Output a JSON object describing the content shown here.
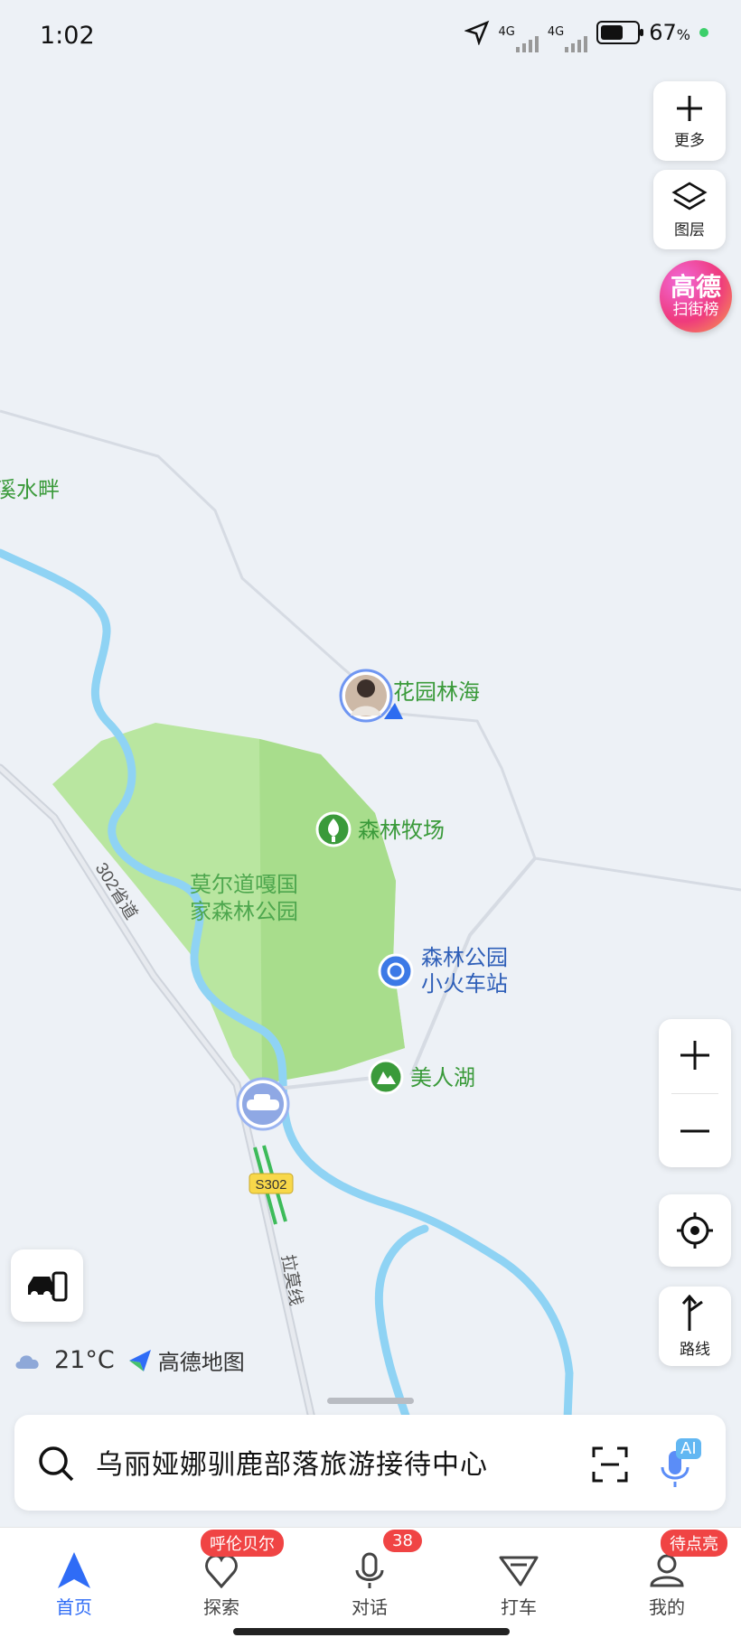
{
  "status": {
    "time": "1:02",
    "net1": "4G",
    "net2": "4G",
    "battery": "67",
    "battery_unit": "%",
    "battery_level": 0.67
  },
  "controls": {
    "more_label": "更多",
    "layers_label": "图层",
    "rank_line1": "高德",
    "rank_line2": "扫街榜",
    "route_label": "路线"
  },
  "map": {
    "labels": {
      "partial_place": "溪水畔",
      "user_place": "花园林海",
      "forest_ranch": "森林牧场",
      "park_line1": "莫尔道嘎国",
      "park_line2": "家森林公园",
      "train_line1": "森林公园",
      "train_line2": "小火车站",
      "lake": "美人湖",
      "road_302": "302省道",
      "road_s302": "S302",
      "road_lamo": "拉莫线"
    }
  },
  "weather": {
    "temp": "21°C",
    "brand": "高德地图"
  },
  "search": {
    "text": "乌丽娅娜驯鹿部落旅游接待中心",
    "ai_badge": "AI"
  },
  "tabs": [
    {
      "label": "首页",
      "badge": ""
    },
    {
      "label": "探索",
      "badge": "呼伦贝尔"
    },
    {
      "label": "对话",
      "badge": "38"
    },
    {
      "label": "打车",
      "badge": ""
    },
    {
      "label": "我的",
      "badge": "待点亮"
    }
  ],
  "colors": {
    "accent": "#2f6cf6",
    "badge": "#f04444",
    "park": "#b9e6a0",
    "river": "#8fd3f4",
    "poi_green": "#3a9a3a"
  }
}
